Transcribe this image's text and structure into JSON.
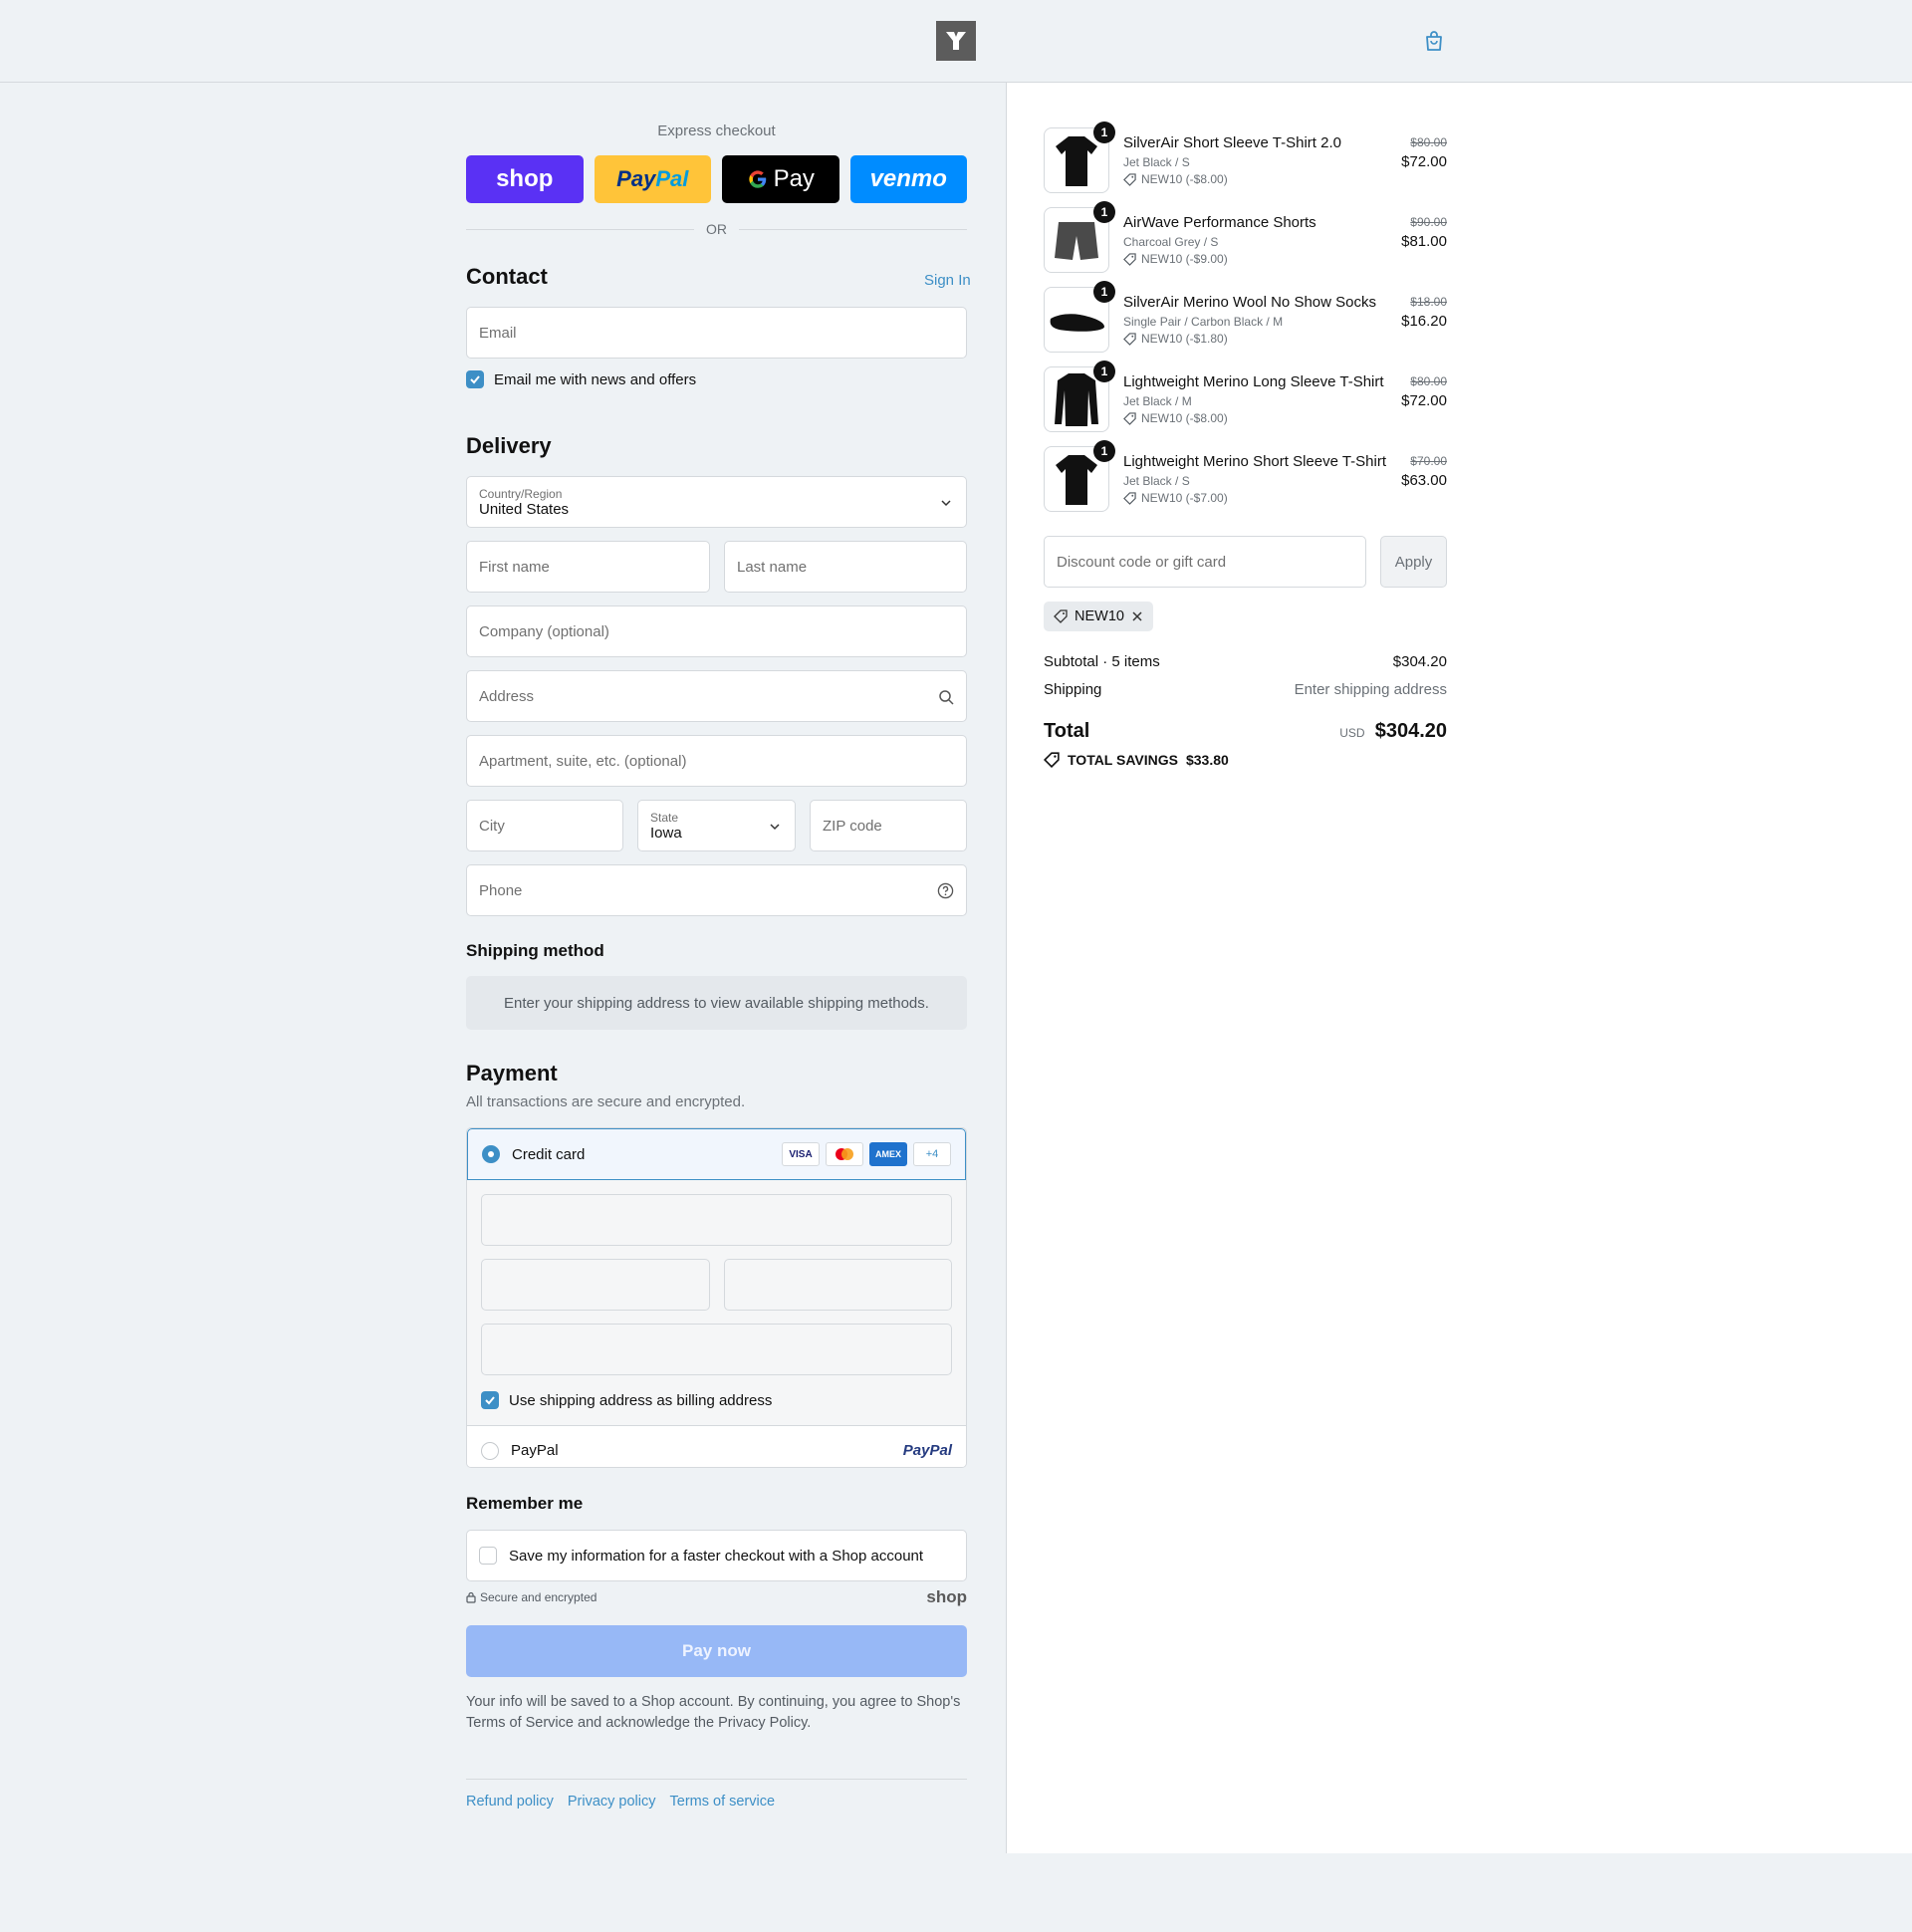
{
  "express": {
    "title": "Express checkout",
    "shop_label": "shop",
    "paypal_label_1": "Pay",
    "paypal_label_2": "Pal",
    "gpay_label": "Pay",
    "venmo_label": "venmo",
    "or_label": "OR"
  },
  "contact": {
    "heading": "Contact",
    "sign_in": "Sign In",
    "email_placeholder": "Email",
    "newsletter_label": "Email me with news and offers",
    "newsletter_checked": true
  },
  "delivery": {
    "heading": "Delivery",
    "country_label": "Country/Region",
    "country_value": "United States",
    "first_name": "First name",
    "last_name": "Last name",
    "company": "Company (optional)",
    "address": "Address",
    "apartment": "Apartment, suite, etc. (optional)",
    "city": "City",
    "state_label": "State",
    "state_value": "Iowa",
    "zip": "ZIP code",
    "phone": "Phone"
  },
  "shipping_method": {
    "heading": "Shipping method",
    "message": "Enter your shipping address to view available shipping methods."
  },
  "payment": {
    "heading": "Payment",
    "subtitle": "All transactions are secure and encrypted.",
    "credit_card_label": "Credit card",
    "card_logos": [
      "VISA",
      "mastercard",
      "AMEX"
    ],
    "more_cards": "+4",
    "billing_label": "Use shipping address as billing address",
    "billing_checked": true,
    "paypal_label": "PayPal",
    "paypal_logo": "PayPal"
  },
  "remember": {
    "heading": "Remember me",
    "save_label": "Save my information for a faster checkout with a Shop account",
    "secure_label": "Secure and encrypted",
    "shop_logo": "shop"
  },
  "pay_now": "Pay now",
  "legal": {
    "line1": "Your info will be saved to a Shop account. By continuing, you agree to Shop's",
    "tos": "Terms of Service",
    "mid": "and acknowledge the",
    "privacy": "Privacy Policy",
    "end": "."
  },
  "footer_links": [
    "Refund policy",
    "Privacy policy",
    "Terms of service"
  ],
  "order": {
    "items": [
      {
        "name": "SilverAir Short Sleeve T-Shirt 2.0",
        "variant": "Jet Black / S",
        "discount": "NEW10 (-$8.00)",
        "old_price": "$80.00",
        "price": "$72.00",
        "qty": "1",
        "icon": "tshirt-icon"
      },
      {
        "name": "AirWave Performance Shorts",
        "variant": "Charcoal Grey / S",
        "discount": "NEW10 (-$9.00)",
        "old_price": "$90.00",
        "price": "$81.00",
        "qty": "1",
        "icon": "shorts-icon"
      },
      {
        "name": "SilverAir Merino Wool No Show Socks",
        "variant": "Single Pair / Carbon Black / M",
        "discount": "NEW10 (-$1.80)",
        "old_price": "$18.00",
        "price": "$16.20",
        "qty": "1",
        "icon": "socks-icon"
      },
      {
        "name": "Lightweight Merino Long Sleeve T-Shirt",
        "variant": "Jet Black / M",
        "discount": "NEW10 (-$8.00)",
        "old_price": "$80.00",
        "price": "$72.00",
        "qty": "1",
        "icon": "long-sleeve-icon"
      },
      {
        "name": "Lightweight Merino Short Sleeve T-Shirt",
        "variant": "Jet Black / S",
        "discount": "NEW10 (-$7.00)",
        "old_price": "$70.00",
        "price": "$63.00",
        "qty": "1",
        "icon": "tshirt-icon"
      }
    ],
    "discount_placeholder": "Discount code or gift card",
    "apply_label": "Apply",
    "applied_code": "NEW10",
    "subtotal_label": "Subtotal · 5 items",
    "subtotal_value": "$304.20",
    "shipping_label": "Shipping",
    "shipping_value": "Enter shipping address",
    "total_label": "Total",
    "currency": "USD",
    "total_value": "$304.20",
    "savings_label": "TOTAL SAVINGS",
    "savings_value": "$33.80"
  },
  "colors": {
    "accent": "#3d8fc6",
    "shop_purple": "#5a31f4",
    "paypal_yellow": "#ffc439",
    "venmo_blue": "#008cff",
    "pay_button": "#97b8f6"
  }
}
